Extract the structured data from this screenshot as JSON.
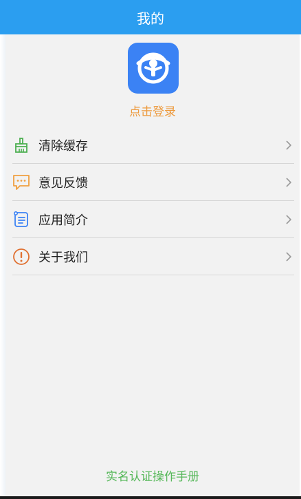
{
  "header": {
    "title": "我的"
  },
  "profile": {
    "login_label": "点击登录"
  },
  "menu": {
    "items": [
      {
        "label": "清除缓存",
        "icon": "broom-icon",
        "color": "#4caf50"
      },
      {
        "label": "意见反馈",
        "icon": "feedback-chat-icon",
        "color": "#f0a040"
      },
      {
        "label": "应用简介",
        "icon": "document-list-icon",
        "color": "#3b82f4"
      },
      {
        "label": "关于我们",
        "icon": "info-circle-icon",
        "color": "#e07030"
      }
    ]
  },
  "footer": {
    "manual_link": "实名认证操作手册"
  },
  "colors": {
    "header": "#2b9ef0",
    "accent_orange": "#ed9a3d",
    "accent_green": "#57b85a",
    "logo": "#3b82f4"
  }
}
